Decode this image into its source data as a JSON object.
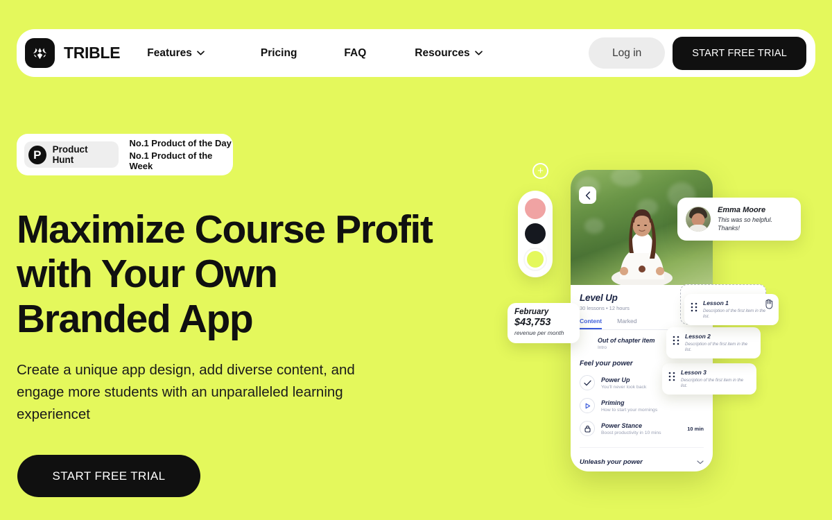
{
  "brand": {
    "name": "TRIBLE",
    "logo_icon": "trible-moth-logo-icon"
  },
  "nav": {
    "links": [
      {
        "label": "Features",
        "has_caret": true
      },
      {
        "label": "Pricing",
        "has_caret": false
      },
      {
        "label": "FAQ",
        "has_caret": false
      },
      {
        "label": "Resources",
        "has_caret": true
      }
    ],
    "login_label": "Log in",
    "trial_label": "START FREE TRIAL"
  },
  "badge": {
    "product_hunt_label": "Product Hunt",
    "logo_letter": "P",
    "line1": "No.1 Product of the Day",
    "line2": "No.1 Product of the Week"
  },
  "hero": {
    "title": "Maximize Course Profit with Your Own Branded App",
    "subtitle": "Create a unique app design, add diverse content, and engage more students with an unparalleled learning experiencet",
    "cta_label": "START FREE TRIAL"
  },
  "art": {
    "plus_glyph": "+",
    "swatches": [
      {
        "name": "pink",
        "color": "#f0a3a3"
      },
      {
        "name": "black",
        "color": "#15181f"
      },
      {
        "name": "lime",
        "color": "#e4f85c"
      }
    ],
    "phone": {
      "back_icon": "chevron-left-icon",
      "course_title": "Level Up",
      "course_meta": "30 lessons • 12 hours",
      "tabs": [
        {
          "label": "Content",
          "active": true
        },
        {
          "label": "Marked",
          "active": false
        }
      ],
      "chapter_title": "Out of chapter item",
      "chapter_sub": "Intro",
      "section_heading": "Feel your power",
      "lessons": [
        {
          "icon": "check-icon",
          "name": "Power Up",
          "desc": "You'll never look back",
          "time": ""
        },
        {
          "icon": "play-icon",
          "name": "Priming",
          "desc": "How to start your mornings",
          "time": ""
        },
        {
          "icon": "lock-icon",
          "name": "Power Stance",
          "desc": "Boost productivity in 10 mins",
          "time": "10 min"
        }
      ],
      "accordion_label": "Unleash your power"
    },
    "testimonial": {
      "name": "Emma Moore",
      "message": "This was so helpful. Thanks!"
    },
    "revenue": {
      "month": "February",
      "amount": "$43,753",
      "label": "revenue per month"
    },
    "lesson_cards": [
      {
        "title": "Lesson 1",
        "desc": "Description of the first item in the list."
      },
      {
        "title": "Lesson 2",
        "desc": "Description of the first item in the list."
      },
      {
        "title": "Lesson 3",
        "desc": "Description of the first item in the list."
      }
    ]
  },
  "colors": {
    "background": "#e4f85c",
    "ink": "#101010",
    "surface": "#ffffff",
    "accent_blue": "#3b5bdb",
    "muted": "#8b91a6"
  }
}
